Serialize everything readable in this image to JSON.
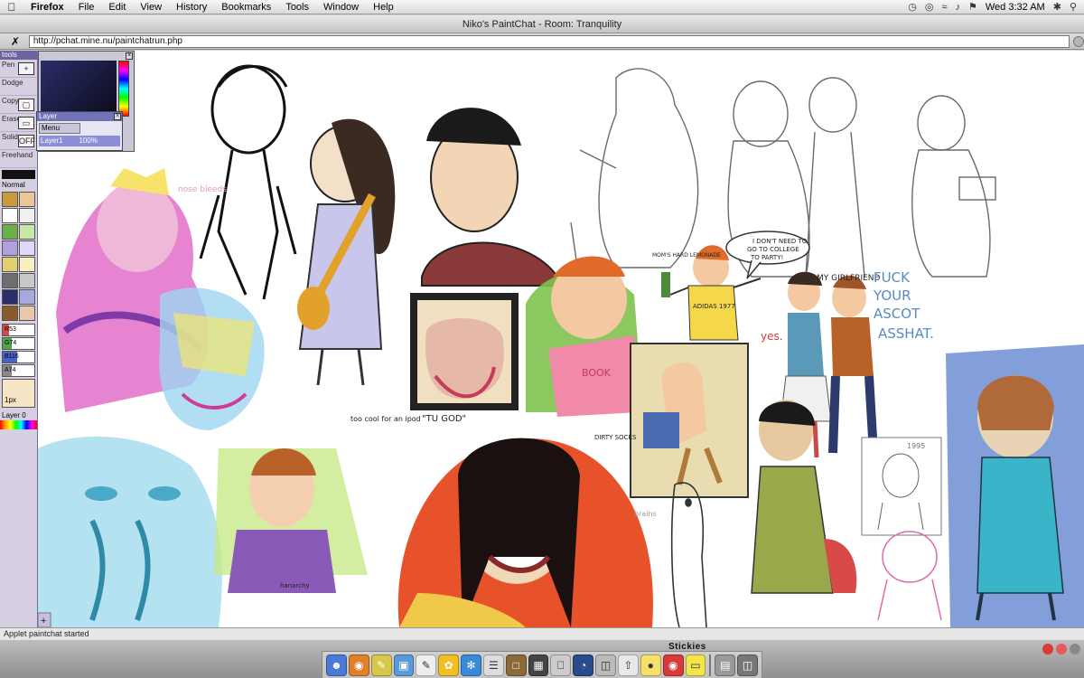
{
  "menubar": {
    "apple": "",
    "app_name": "Firefox",
    "items": [
      "File",
      "Edit",
      "View",
      "History",
      "Bookmarks",
      "Tools",
      "Window",
      "Help"
    ],
    "clock": "Wed 3:32 AM"
  },
  "window": {
    "title": "Niko's PaintChat - Room: Tranquility",
    "url": "http://pchat.mine.nu/paintchatrun.php"
  },
  "tools": {
    "title": "tools",
    "pen": "Pen",
    "dodge": "Dodge",
    "copy": "Copy",
    "erase": "Erase",
    "solid": "Solid",
    "freehand": "Freehand",
    "off_button": "OFF",
    "mode": "Normal",
    "sliders": [
      {
        "label": "R53",
        "fraction": 0.21,
        "color": "#d24a4a"
      },
      {
        "label": "G74",
        "fraction": 0.29,
        "color": "#4aa84a"
      },
      {
        "label": "B116",
        "fraction": 0.45,
        "color": "#4a62c8"
      },
      {
        "label": "A74",
        "fraction": 0.29,
        "color": "#888888"
      }
    ],
    "brush_size": "1px",
    "layer_label": "Layer 0",
    "swatches": [
      "#c89a3a",
      "#e8c89a",
      "#ffffff",
      "#f0f0f0",
      "#6ab04a",
      "#c8e8a8",
      "#b0a0e0",
      "#e0d8f8",
      "#e0d070",
      "#f8f0c0",
      "#6e6e6e",
      "#c8c8c8",
      "#2c2c6a",
      "#a8a8e0",
      "#8a5a2a",
      "#e8c8a8"
    ]
  },
  "layer_window": {
    "title": "Layer",
    "menu": "Menu",
    "layer_name": "Layer1",
    "opacity": "100%"
  },
  "canvas": {
    "doodle_texts": [
      "I DON'T NEED TO GO TO COLLEGE TO PARTY!",
      "MOM'S HARD LEMONADE",
      "ADIDAS 1977",
      "yes.",
      "MY GIRLFRIEND",
      "FUCK YOUR ASCOT ASSHAT.",
      "too cool for an ipod",
      "\"TU GOD\"",
      "nose bleeds",
      "1995",
      "DIRTY SOCKS",
      "BOOK",
      "brains",
      "hanarchy"
    ]
  },
  "status": {
    "text": "Applet paintchat started"
  },
  "dock": {
    "label": "Stickies"
  }
}
